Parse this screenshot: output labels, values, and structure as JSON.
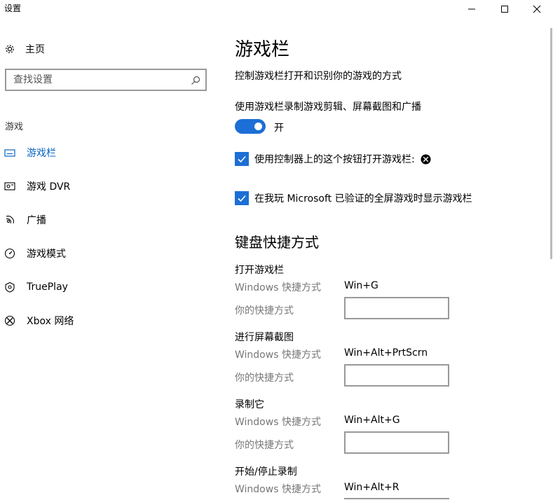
{
  "window": {
    "title": "设置"
  },
  "sidebar": {
    "home_label": "主页",
    "search_placeholder": "查找设置",
    "section_label": "游戏",
    "items": [
      {
        "label": "游戏栏",
        "icon": "game-bar-icon",
        "active": true
      },
      {
        "label": "游戏 DVR",
        "icon": "game-dvr-icon",
        "active": false
      },
      {
        "label": "广播",
        "icon": "broadcast-icon",
        "active": false
      },
      {
        "label": "游戏模式",
        "icon": "game-mode-icon",
        "active": false
      },
      {
        "label": "TruePlay",
        "icon": "trueplay-icon",
        "active": false
      },
      {
        "label": "Xbox 网络",
        "icon": "xbox-icon",
        "active": false
      }
    ]
  },
  "main": {
    "title": "游戏栏",
    "description": "控制游戏栏打开和识别你的游戏的方式",
    "record_label": "使用游戏栏录制游戏剪辑、屏幕截图和广播",
    "toggle_state": "开",
    "toggle_on": true,
    "checkbox_controller": "使用控制器上的这个按钮打开游戏栏:",
    "checkbox_fullscreen": "在我玩 Microsoft 已验证的全屏游戏时显示游戏栏",
    "shortcuts_header": "键盘快捷方式",
    "windows_shortcut_label": "Windows 快捷方式",
    "your_shortcut_label": "你的快捷方式",
    "shortcuts": [
      {
        "title": "打开游戏栏",
        "windows": "Win+G",
        "custom": ""
      },
      {
        "title": "进行屏幕截图",
        "windows": "Win+Alt+PrtScrn",
        "custom": ""
      },
      {
        "title": "录制它",
        "windows": "Win+Alt+G",
        "custom": ""
      },
      {
        "title": "开始/停止录制",
        "windows": "Win+Alt+R",
        "custom": ""
      }
    ]
  },
  "colors": {
    "accent": "#1c6fd6",
    "active_text": "#0a64c2"
  }
}
